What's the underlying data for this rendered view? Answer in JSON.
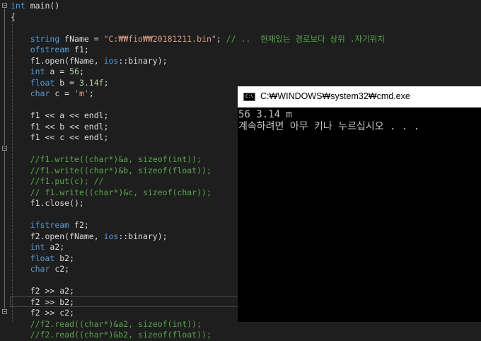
{
  "editor": {
    "lines": [
      {
        "t": [
          {
            "c": "kw",
            "s": "int"
          },
          {
            "c": "txt",
            "s": " main()"
          }
        ]
      },
      {
        "t": [
          {
            "c": "txt",
            "s": "{"
          }
        ]
      },
      {
        "t": []
      },
      {
        "t": [
          {
            "c": "txt",
            "s": "    "
          },
          {
            "c": "kw",
            "s": "string"
          },
          {
            "c": "txt",
            "s": " fName = "
          },
          {
            "c": "str",
            "s": "\"C:₩₩fio₩₩20181211.bin\""
          },
          {
            "c": "txt",
            "s": "; "
          },
          {
            "c": "cm",
            "s": "// ..  현재있는 경로보다 상위 .자기위치"
          }
        ]
      },
      {
        "t": [
          {
            "c": "txt",
            "s": "    "
          },
          {
            "c": "kw",
            "s": "ofstream"
          },
          {
            "c": "txt",
            "s": " f1;"
          }
        ]
      },
      {
        "t": [
          {
            "c": "txt",
            "s": "    f1.open(fName, "
          },
          {
            "c": "kw",
            "s": "ios"
          },
          {
            "c": "txt",
            "s": "::binary);"
          }
        ]
      },
      {
        "t": [
          {
            "c": "txt",
            "s": "    "
          },
          {
            "c": "kw",
            "s": "int"
          },
          {
            "c": "txt",
            "s": " a = "
          },
          {
            "c": "num",
            "s": "56"
          },
          {
            "c": "txt",
            "s": ";"
          }
        ]
      },
      {
        "t": [
          {
            "c": "txt",
            "s": "    "
          },
          {
            "c": "kw",
            "s": "float"
          },
          {
            "c": "txt",
            "s": " b = "
          },
          {
            "c": "num",
            "s": "3.14f"
          },
          {
            "c": "txt",
            "s": ";"
          }
        ]
      },
      {
        "t": [
          {
            "c": "txt",
            "s": "    "
          },
          {
            "c": "kw",
            "s": "char"
          },
          {
            "c": "txt",
            "s": " c = "
          },
          {
            "c": "str",
            "s": "'m'"
          },
          {
            "c": "txt",
            "s": ";"
          }
        ]
      },
      {
        "t": []
      },
      {
        "t": [
          {
            "c": "txt",
            "s": "    f1 << a << endl;"
          }
        ]
      },
      {
        "t": [
          {
            "c": "txt",
            "s": "    f1 << b << endl;"
          }
        ]
      },
      {
        "t": [
          {
            "c": "txt",
            "s": "    f1 << c << endl;"
          }
        ]
      },
      {
        "t": []
      },
      {
        "t": [
          {
            "c": "txt",
            "s": "    "
          },
          {
            "c": "cm",
            "s": "//f1.write((char*)&a, sizeof(int));"
          }
        ]
      },
      {
        "t": [
          {
            "c": "txt",
            "s": "    "
          },
          {
            "c": "cm",
            "s": "//f1.write((char*)&b, sizeof(float));"
          }
        ]
      },
      {
        "t": [
          {
            "c": "txt",
            "s": "    "
          },
          {
            "c": "cm",
            "s": "//f1.put(c); //"
          }
        ]
      },
      {
        "t": [
          {
            "c": "txt",
            "s": "    "
          },
          {
            "c": "cm",
            "s": "// f1.write((char*)&c, sizeof(char));"
          }
        ]
      },
      {
        "t": [
          {
            "c": "txt",
            "s": "    f1.close();"
          }
        ]
      },
      {
        "t": []
      },
      {
        "t": [
          {
            "c": "txt",
            "s": "    "
          },
          {
            "c": "kw",
            "s": "ifstream"
          },
          {
            "c": "txt",
            "s": " f2;"
          }
        ]
      },
      {
        "t": [
          {
            "c": "txt",
            "s": "    f2.open(fName, "
          },
          {
            "c": "kw",
            "s": "ios"
          },
          {
            "c": "txt",
            "s": "::binary);"
          }
        ]
      },
      {
        "t": [
          {
            "c": "txt",
            "s": "    "
          },
          {
            "c": "kw",
            "s": "int"
          },
          {
            "c": "txt",
            "s": " a2;"
          }
        ]
      },
      {
        "t": [
          {
            "c": "txt",
            "s": "    "
          },
          {
            "c": "kw",
            "s": "float"
          },
          {
            "c": "txt",
            "s": " b2;"
          }
        ]
      },
      {
        "t": [
          {
            "c": "txt",
            "s": "    "
          },
          {
            "c": "kw",
            "s": "char"
          },
          {
            "c": "txt",
            "s": " c2;"
          }
        ]
      },
      {
        "t": []
      },
      {
        "t": [
          {
            "c": "txt",
            "s": "    f2 >> a2;"
          }
        ]
      },
      {
        "t": [
          {
            "c": "txt",
            "s": "    f2 >> b2;"
          }
        ]
      },
      {
        "t": [
          {
            "c": "txt",
            "s": "    f2 >> c2;"
          }
        ]
      },
      {
        "t": [
          {
            "c": "txt",
            "s": "    "
          },
          {
            "c": "cm",
            "s": "//f2.read((char*)&a2, sizeof(int));"
          }
        ]
      },
      {
        "t": [
          {
            "c": "txt",
            "s": "    "
          },
          {
            "c": "cm",
            "s": "//f2.read((char*)&b2, sizeof(float));"
          }
        ]
      }
    ]
  },
  "cmd_window": {
    "title": "C:₩WINDOWS₩system32₩cmd.exe",
    "icon_label": "C:\\",
    "output": [
      "56 3.14 m",
      "계속하려면 아무 키나 누르십시오 . . ."
    ]
  },
  "colors": {
    "keyword": "#569cd6",
    "string": "#d69d85",
    "comment": "#57a64a",
    "number": "#b5cea8",
    "text": "#dcdcdc",
    "editor_bg": "#1e1e1e",
    "console_bg": "#000000"
  }
}
